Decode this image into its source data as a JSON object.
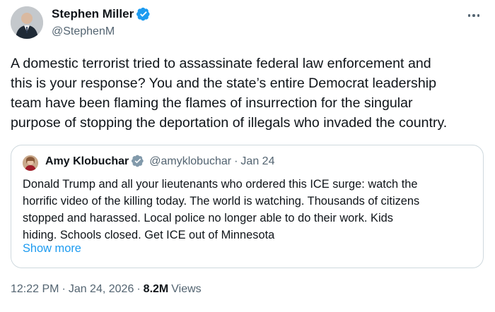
{
  "tweet": {
    "author": {
      "name": "Stephen Miller",
      "handle": "@StephenM",
      "verified_icon": "verified-badge-icon",
      "avatar": "author-avatar"
    },
    "text": "A domestic terrorist tried to assassinate federal law enforcement and\nthis is your response? You and the state’s entire Democrat leadership\nteam have been flaming the flames of insurrection for the singular\npurpose of stopping the deportation of illegals who invaded the country.",
    "more_icon": "more-options-icon",
    "quote": {
      "author_name": "Amy Klobuchar",
      "handle": "@amyklobuchar",
      "separator": "·",
      "date": "Jan 24",
      "text": "Donald Trump and all your lieutenants who ordered this ICE surge: watch the\nhorrific video of the killing today. The world is watching. Thousands  of citizens\nstopped and harassed. Local police no longer able to do their work. Kids\nhiding. Schools closed. Get ICE out of Minnesota",
      "show_more": "Show more"
    },
    "meta": {
      "time": "12:22 PM",
      "separator": "·",
      "date": "Jan 24, 2026",
      "views_count": "8.2M",
      "views_label": "Views"
    }
  },
  "colors": {
    "text": "#0f1419",
    "secondary": "#536471",
    "link": "#1d9bf0",
    "verified": "#1d9bf0",
    "border": "#cfd9de"
  }
}
